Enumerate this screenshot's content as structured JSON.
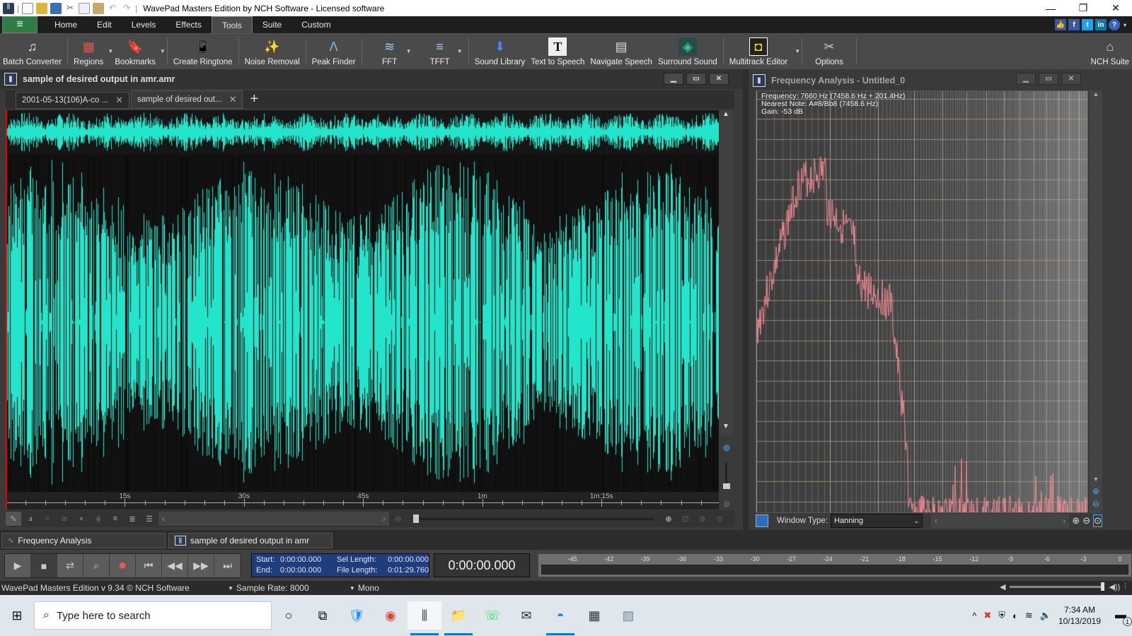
{
  "window": {
    "title": "WavePad Masters Edition by NCH Software - Licensed software",
    "controls": {
      "minimize": "—",
      "restore": "❐",
      "close": "✕"
    }
  },
  "quick_access": [
    "app-icon",
    "new-file-icon",
    "open-file-icon",
    "save-icon",
    "cut-icon",
    "copy-icon",
    "paste-icon",
    "undo-icon",
    "redo-icon"
  ],
  "menu": {
    "hamburger": "≡",
    "tabs": [
      {
        "label": "Home"
      },
      {
        "label": "Edit"
      },
      {
        "label": "Levels"
      },
      {
        "label": "Effects"
      },
      {
        "label": "Tools",
        "active": true
      },
      {
        "label": "Suite"
      },
      {
        "label": "Custom"
      }
    ],
    "social": [
      "👍",
      "f",
      "t",
      "in",
      "?"
    ]
  },
  "toolbar": {
    "items": [
      {
        "label": "Batch Converter",
        "icon": "♫"
      },
      {
        "label": "Regions",
        "icon": "▦",
        "dropdown": true
      },
      {
        "label": "Bookmarks",
        "icon": "🔖",
        "dropdown": true
      },
      {
        "label": "Create Ringtone",
        "icon": "📱"
      },
      {
        "label": "Noise Removal",
        "icon": "✨"
      },
      {
        "label": "Peak Finder",
        "icon": "Λ"
      },
      {
        "label": "FFT",
        "icon": "≋",
        "dropdown": true
      },
      {
        "label": "TFFT",
        "icon": "≡",
        "dropdown": true
      },
      {
        "label": "Sound Library",
        "icon": "⬇"
      },
      {
        "label": "Text to Speech",
        "icon": "T"
      },
      {
        "label": "Navigate Speech",
        "icon": "▤"
      },
      {
        "label": "Surround Sound",
        "icon": "◈"
      },
      {
        "label": "Multitrack Editor",
        "icon": "◘",
        "dropdown": true
      },
      {
        "label": "Options",
        "icon": "✂"
      }
    ],
    "nch_suite": "NCH Suite"
  },
  "wave_window": {
    "title": "sample of desired output in amr.amr",
    "tabs": [
      {
        "label": "2001-05-13(106)A-co ...",
        "active": false
      },
      {
        "label": "sample of desired out...",
        "active": true
      }
    ],
    "add_tab": "+",
    "timeline_labels": [
      "15s",
      "30s",
      "45s",
      "1m",
      "1m:15s"
    ],
    "wave_color": "#22e5cc",
    "file_length_seconds": 89.76
  },
  "freq_window": {
    "title": "Frequency Analysis - Untitled_0",
    "info": {
      "frequency": "Frequency: 7660 Hz (7458.6 Hz + 201.4Hz)",
      "nearest_note": "Nearest Note: A#8/Bb8 (7458.6 Hz)",
      "gain": "Gain: -53 dB"
    },
    "window_type_label": "Window Type:",
    "window_type_value": "Hanning",
    "trace_color": "#f08a94"
  },
  "dock": {
    "items": [
      {
        "label": "Frequency Analysis"
      },
      {
        "label": "sample of desired output in amr"
      }
    ]
  },
  "transport": {
    "buttons": [
      "play",
      "stop",
      "loop",
      "scrub",
      "record",
      "go-start",
      "rewind",
      "fast-forward",
      "go-end"
    ],
    "start_label": "Start:",
    "start_value": "0:00:00.000",
    "end_label": "End:",
    "end_value": "0:00:00.000",
    "sel_length_label": "Sel Length:",
    "sel_length_value": "0:00:00.000",
    "file_length_label": "File Length:",
    "file_length_value": "0:01:29.760",
    "time_display": "0:00:00.000",
    "meter_labels": [
      "-45",
      "-42",
      "-39",
      "-36",
      "-33",
      "-30",
      "-27",
      "-24",
      "-21",
      "-18",
      "-15",
      "-12",
      "-9",
      "-6",
      "-3",
      "0"
    ]
  },
  "status": {
    "version": "WavePad Masters Edition v 9.34 © NCH Software",
    "sample_rate": "Sample Rate: 8000",
    "channels": "Mono",
    "volume_level": 0.98
  },
  "taskbar": {
    "search_placeholder": "Type here to search",
    "apps": [
      {
        "name": "cortana",
        "glyph": "○"
      },
      {
        "name": "task-view",
        "glyph": "⧉"
      },
      {
        "name": "vpn",
        "glyph": "🛡"
      },
      {
        "name": "chrome",
        "glyph": "◉"
      },
      {
        "name": "wavepad",
        "glyph": "⫼",
        "active": true,
        "running": true
      },
      {
        "name": "file-explorer",
        "glyph": "📁",
        "running": true
      },
      {
        "name": "whatsapp",
        "glyph": "☏"
      },
      {
        "name": "mail",
        "glyph": "✉"
      },
      {
        "name": "openoffice",
        "glyph": "◓",
        "running": true
      },
      {
        "name": "calculator",
        "glyph": "▦"
      },
      {
        "name": "resource-monitor",
        "glyph": "▨"
      }
    ],
    "time": "7:34 AM",
    "date": "10/13/2019",
    "notifications": "1"
  }
}
